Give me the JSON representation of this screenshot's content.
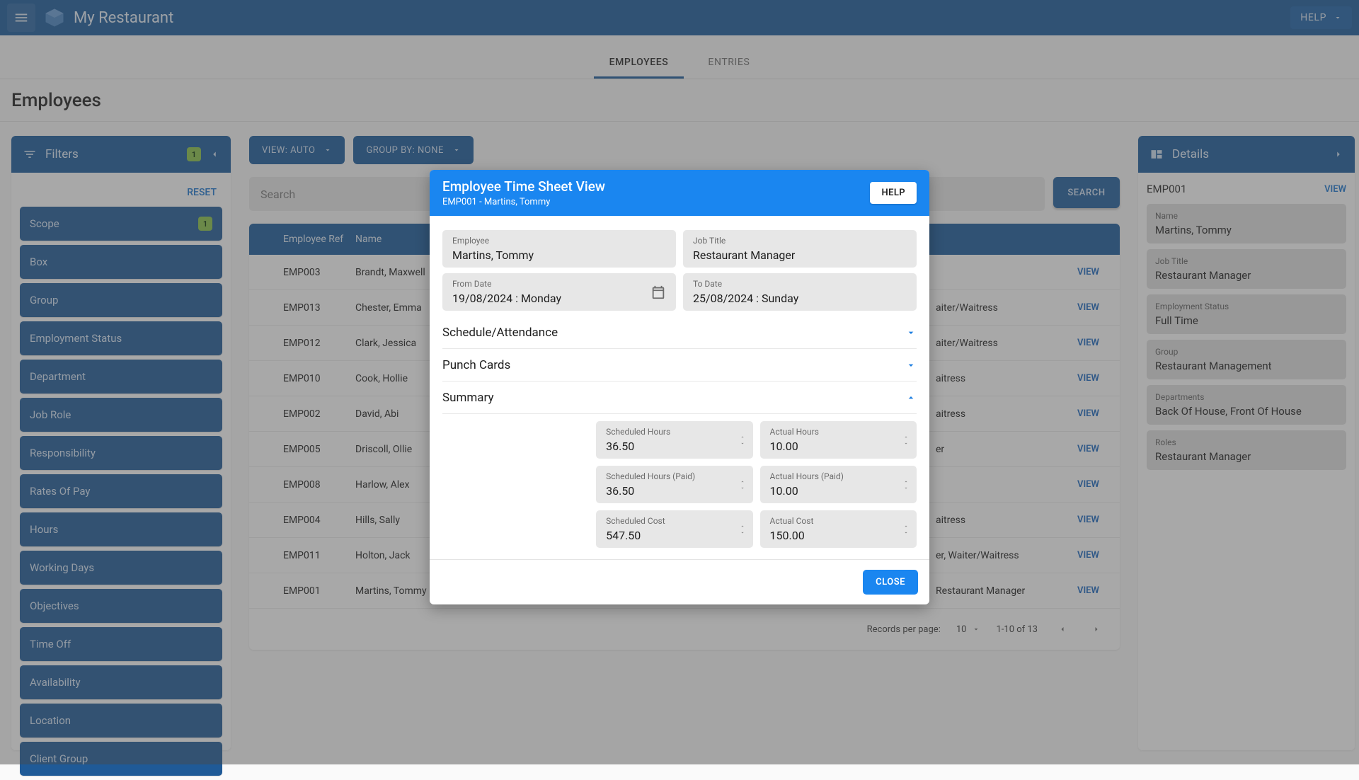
{
  "appbar": {
    "title": "My Restaurant",
    "help_label": "HELP"
  },
  "tabs": {
    "employees": "EMPLOYEES",
    "entries": "ENTRIES"
  },
  "page": {
    "title": "Employees"
  },
  "filters": {
    "header": "Filters",
    "badge": "1",
    "reset": "RESET",
    "items": [
      "Scope",
      "Box",
      "Group",
      "Employment Status",
      "Department",
      "Job Role",
      "Responsibility",
      "Rates Of Pay",
      "Hours",
      "Working Days",
      "Objectives",
      "Time Off",
      "Availability",
      "Location",
      "Client Group"
    ],
    "scope_badge": "1"
  },
  "toolbar": {
    "view_btn": "VIEW: AUTO",
    "group_btn": "GROUP BY: NONE"
  },
  "search": {
    "placeholder": "Search",
    "button": "SEARCH"
  },
  "table": {
    "headers": {
      "ref": "Employee Ref",
      "name": "Name"
    },
    "rows": [
      {
        "ref": "EMP003",
        "name": "Brandt, Maxwell",
        "job": "",
        "dept": "",
        "roles": "",
        "view": "VIEW"
      },
      {
        "ref": "EMP013",
        "name": "Chester, Emma",
        "job": "",
        "dept": "",
        "roles": "aiter/Waitress",
        "view": "VIEW"
      },
      {
        "ref": "EMP012",
        "name": "Clark, Jessica",
        "job": "",
        "dept": "",
        "roles": "aiter/Waitress",
        "view": "VIEW"
      },
      {
        "ref": "EMP010",
        "name": "Cook, Hollie",
        "job": "",
        "dept": "",
        "roles": "aitress",
        "view": "VIEW"
      },
      {
        "ref": "EMP002",
        "name": "David, Abi",
        "job": "",
        "dept": "",
        "roles": "aitress",
        "view": "VIEW"
      },
      {
        "ref": "EMP005",
        "name": "Driscoll, Ollie",
        "job": "",
        "dept": "",
        "roles": "er",
        "view": "VIEW"
      },
      {
        "ref": "EMP008",
        "name": "Harlow, Alex",
        "job": "",
        "dept": "",
        "roles": "",
        "view": "VIEW"
      },
      {
        "ref": "EMP004",
        "name": "Hills, Sally",
        "job": "",
        "dept": "",
        "roles": "aitress",
        "view": "VIEW"
      },
      {
        "ref": "EMP011",
        "name": "Holton, Jack",
        "job": "",
        "dept": "",
        "roles": "er, Waiter/Waitress",
        "view": "VIEW"
      },
      {
        "ref": "EMP001",
        "name": "Martins, Tommy",
        "job": "Restaurant Manager",
        "dept": "Back Of House, Front Of House",
        "roles": "Restaurant Manager",
        "view": "VIEW"
      }
    ],
    "pager": {
      "rpp_label": "Records per page:",
      "rpp_value": "10",
      "range": "1-10 of 13"
    }
  },
  "details": {
    "header": "Details",
    "id": "EMP001",
    "view": "VIEW",
    "cards": [
      {
        "lbl": "Name",
        "val": "Martins, Tommy"
      },
      {
        "lbl": "Job Title",
        "val": "Restaurant Manager"
      },
      {
        "lbl": "Employment Status",
        "val": "Full Time"
      },
      {
        "lbl": "Group",
        "val": "Restaurant Management"
      },
      {
        "lbl": "Departments",
        "val": "Back Of House, Front Of House"
      },
      {
        "lbl": "Roles",
        "val": "Restaurant Manager"
      }
    ]
  },
  "modal": {
    "title": "Employee Time Sheet View",
    "subtitle": "EMP001 - Martins, Tommy",
    "help": "HELP",
    "employee": {
      "lbl": "Employee",
      "val": "Martins, Tommy"
    },
    "jobtitle": {
      "lbl": "Job Title",
      "val": "Restaurant Manager"
    },
    "from": {
      "lbl": "From Date",
      "val": "19/08/2024 : Monday"
    },
    "to": {
      "lbl": "To Date",
      "val": "25/08/2024 : Sunday"
    },
    "acc": {
      "schedule": "Schedule/Attendance",
      "punch": "Punch Cards",
      "summary": "Summary"
    },
    "summary": {
      "sched_hours": {
        "lbl": "Scheduled Hours",
        "val": "36.50"
      },
      "actual_hours": {
        "lbl": "Actual Hours",
        "val": "10.00"
      },
      "sched_hours_paid": {
        "lbl": "Scheduled Hours (Paid)",
        "val": "36.50"
      },
      "actual_hours_paid": {
        "lbl": "Actual Hours (Paid)",
        "val": "10.00"
      },
      "sched_cost": {
        "lbl": "Scheduled Cost",
        "val": "547.50"
      },
      "actual_cost": {
        "lbl": "Actual Cost",
        "val": "150.00"
      }
    },
    "close": "CLOSE"
  }
}
